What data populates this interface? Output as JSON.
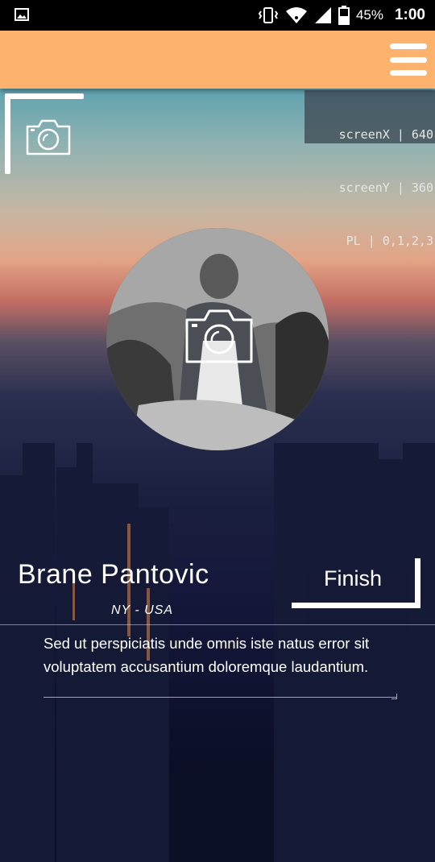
{
  "status_bar": {
    "battery": "45%",
    "time": "1:00",
    "icons": [
      "image-notification-icon",
      "vibrate-icon",
      "wifi-icon",
      "signal-icon",
      "battery-icon"
    ]
  },
  "toolbar": {
    "background": "#fdb26e",
    "menu_icon": "hamburger-menu-icon"
  },
  "debug_overlay": {
    "line1": "screenX | 640",
    "line2": "screenY | 360",
    "line3": " PL | 0,1,2,3"
  },
  "cover": {
    "icon": "camera-icon"
  },
  "profile": {
    "name": "Brane Pantovic",
    "location": "NY - USA",
    "avatar_icon": "camera-icon"
  },
  "finish": {
    "label": "Finish"
  },
  "bio": {
    "text": "Sed ut perspiciatis unde omnis iste natus error sit voluptatem accusantium doloremque laudantium."
  }
}
